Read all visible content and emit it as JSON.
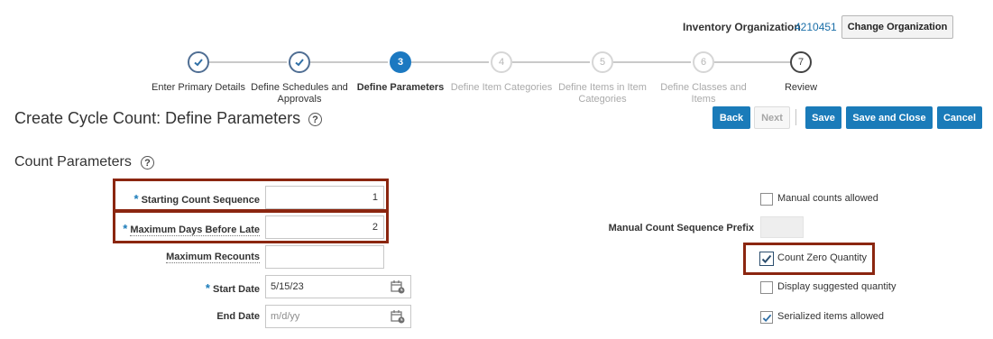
{
  "header": {
    "org_label": "Inventory Organization",
    "org_value": "4210451",
    "change_org_label": "Change Organization"
  },
  "train": {
    "steps": [
      {
        "number": "",
        "state": "done",
        "label_line1": "Enter Primary Details",
        "label_line2": ""
      },
      {
        "number": "",
        "state": "done",
        "label_line1": "Define Schedules and",
        "label_line2": "Approvals"
      },
      {
        "number": "3",
        "state": "current",
        "label_line1": "Define Parameters",
        "label_line2": ""
      },
      {
        "number": "4",
        "state": "future",
        "label_line1": "Define Item Categories",
        "label_line2": ""
      },
      {
        "number": "5",
        "state": "future",
        "label_line1": "Define Items in Item",
        "label_line2": "Categories"
      },
      {
        "number": "6",
        "state": "future",
        "label_line1": "Define Classes and",
        "label_line2": "Items"
      },
      {
        "number": "7",
        "state": "last",
        "label_line1": "Review",
        "label_line2": ""
      }
    ]
  },
  "page": {
    "title": "Create Cycle Count: Define Parameters",
    "help_glyph": "?"
  },
  "actions": {
    "back": "Back",
    "next": "Next",
    "save": "Save",
    "save_close": "Save and Close",
    "cancel": "Cancel"
  },
  "section": {
    "title": "Count Parameters"
  },
  "form": {
    "required_mark": "*",
    "starting_count_sequence": {
      "label": "Starting Count Sequence",
      "value": "1"
    },
    "maximum_days_before_late": {
      "label": "Maximum Days Before Late",
      "value": "2"
    },
    "maximum_recounts": {
      "label": "Maximum Recounts",
      "value": ""
    },
    "start_date": {
      "label": "Start Date",
      "value": "5/15/23"
    },
    "end_date": {
      "label": "End Date",
      "placeholder": "m/d/yy"
    },
    "manual_counts_allowed": {
      "label": "Manual counts allowed",
      "checked": false
    },
    "manual_count_sequence_prefix": {
      "label": "Manual Count Sequence Prefix",
      "value": ""
    },
    "count_zero_quantity": {
      "label": "Count Zero Quantity",
      "checked": true
    },
    "display_suggested_quantity": {
      "label": "Display suggested quantity",
      "checked": false
    },
    "serialized_items_allowed": {
      "label": "Serialized items allowed",
      "checked": true
    }
  },
  "colors": {
    "accent": "#1a7bb9",
    "highlight": "#8b2610",
    "done_step": "#4f6e93"
  },
  "icons": [
    "check-icon",
    "help-icon",
    "calendar-icon",
    "checkbox-check-icon"
  ]
}
